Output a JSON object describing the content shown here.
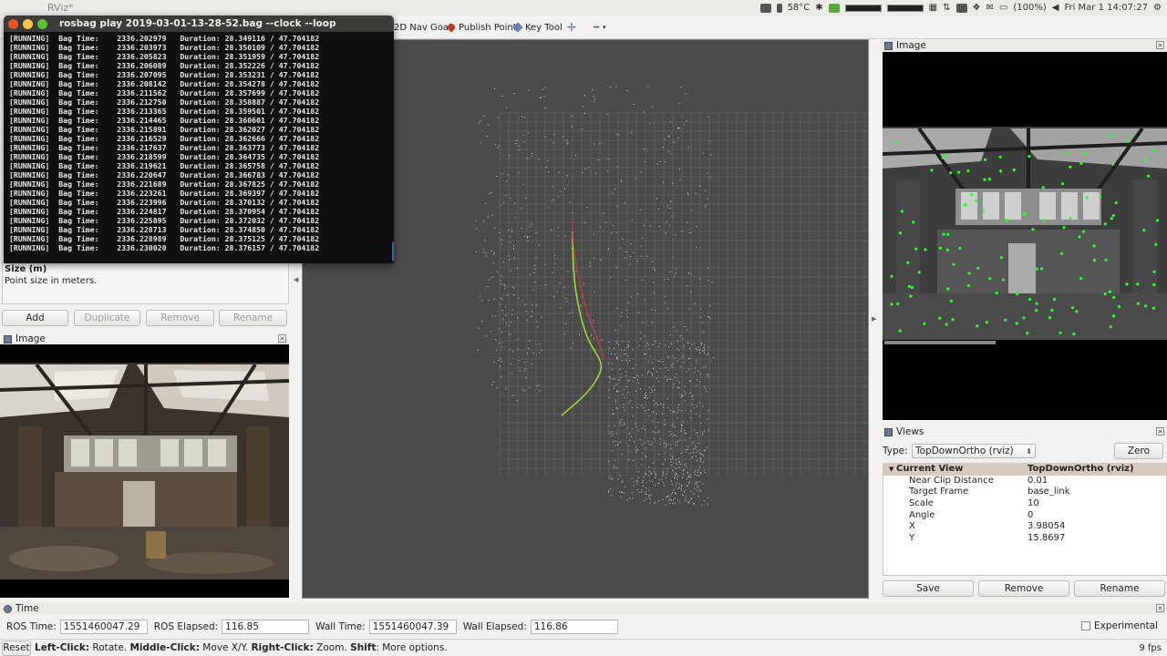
{
  "system": {
    "app_title": "RViz*",
    "temperature": "58°C",
    "battery": "(100%)",
    "clock": "Fri Mar  1 14:07:27"
  },
  "toolbar": {
    "nav_goal": "2D Nav Goal",
    "publish_point": "Publish Point",
    "key_tool": "Key Tool"
  },
  "terminal": {
    "title": "rosbag play 2019-03-01-13-28-52.bag --clock --loop",
    "lines": [
      "[RUNNING]  Bag Time:    2336.202979   Duration: 28.349116 / 47.704182",
      "[RUNNING]  Bag Time:    2336.203973   Duration: 28.350109 / 47.704182",
      "[RUNNING]  Bag Time:    2336.205823   Duration: 28.351959 / 47.704182",
      "[RUNNING]  Bag Time:    2336.206089   Duration: 28.352226 / 47.704182",
      "[RUNNING]  Bag Time:    2336.207095   Duration: 28.353231 / 47.704182",
      "[RUNNING]  Bag Time:    2336.208142   Duration: 28.354278 / 47.704182",
      "[RUNNING]  Bag Time:    2336.211562   Duration: 28.357699 / 47.704182",
      "[RUNNING]  Bag Time:    2336.212750   Duration: 28.358887 / 47.704182",
      "[RUNNING]  Bag Time:    2336.213365   Duration: 28.359501 / 47.704182",
      "[RUNNING]  Bag Time:    2336.214465   Duration: 28.360601 / 47.704182",
      "[RUNNING]  Bag Time:    2336.215891   Duration: 28.362027 / 47.704182",
      "[RUNNING]  Bag Time:    2336.216529   Duration: 28.362666 / 47.704182",
      "[RUNNING]  Bag Time:    2336.217637   Duration: 28.363773 / 47.704182",
      "[RUNNING]  Bag Time:    2336.218599   Duration: 28.364735 / 47.704182",
      "[RUNNING]  Bag Time:    2336.219621   Duration: 28.365758 / 47.704182",
      "[RUNNING]  Bag Time:    2336.220647   Duration: 28.366783 / 47.704182",
      "[RUNNING]  Bag Time:    2336.221689   Duration: 28.367825 / 47.704182",
      "[RUNNING]  Bag Time:    2336.223261   Duration: 28.369397 / 47.704182",
      "[RUNNING]  Bag Time:    2336.223996   Duration: 28.370132 / 47.704182",
      "[RUNNING]  Bag Time:    2336.224817   Duration: 28.370954 / 47.704182",
      "[RUNNING]  Bag Time:    2336.225895   Duration: 28.372032 / 47.704182",
      "[RUNNING]  Bag Time:    2336.228713   Duration: 28.374850 / 47.704182",
      "[RUNNING]  Bag Time:    2336.228989   Duration: 28.375125 / 47.704182",
      "[RUNNING]  Bag Time:    2336.230020   Duration: 28.376157 / 47.704182"
    ]
  },
  "displays": {
    "desc_title": "Size (m)",
    "desc_text": "Point size in meters.",
    "add": "Add",
    "duplicate": "Duplicate",
    "remove": "Remove",
    "rename": "Rename"
  },
  "image_left": {
    "title": "Image"
  },
  "image_right": {
    "title": "Image"
  },
  "views": {
    "title": "Views",
    "type_label": "Type:",
    "type_value": "TopDownOrtho (rviz)",
    "zero": "Zero",
    "current_view_label": "Current View",
    "current_view_value": "TopDownOrtho (rviz)",
    "props": [
      {
        "key": "Near Clip Distance",
        "value": "0.01"
      },
      {
        "key": "Target Frame",
        "value": "base_link"
      },
      {
        "key": "Scale",
        "value": "10"
      },
      {
        "key": "Angle",
        "value": "0"
      },
      {
        "key": "X",
        "value": "3.98054"
      },
      {
        "key": "Y",
        "value": "15.8697"
      }
    ],
    "save": "Save",
    "remove": "Remove",
    "rename": "Rename"
  },
  "time": {
    "title": "Time",
    "ros_time_label": "ROS Time:",
    "ros_time": "1551460047.29",
    "ros_elapsed_label": "ROS Elapsed:",
    "ros_elapsed": "116.85",
    "wall_time_label": "Wall Time:",
    "wall_time": "1551460047.39",
    "wall_elapsed_label": "Wall Elapsed:",
    "wall_elapsed": "116.86",
    "experimental": "Experimental"
  },
  "status": {
    "reset": "Reset",
    "left_click": "Left-Click:",
    "left_action": " Rotate. ",
    "middle_click": "Middle-Click:",
    "middle_action": " Move X/Y. ",
    "right_click": "Right-Click:",
    "right_action": " Zoom. ",
    "shift": "Shift",
    "shift_action": ": More options.",
    "fps": "9 fps"
  },
  "colors": {
    "path_green": "#9bdc3c",
    "path_red": "#d43b3b",
    "feature_green": "#2dff2d",
    "tree_header": "#d9c9bd"
  }
}
